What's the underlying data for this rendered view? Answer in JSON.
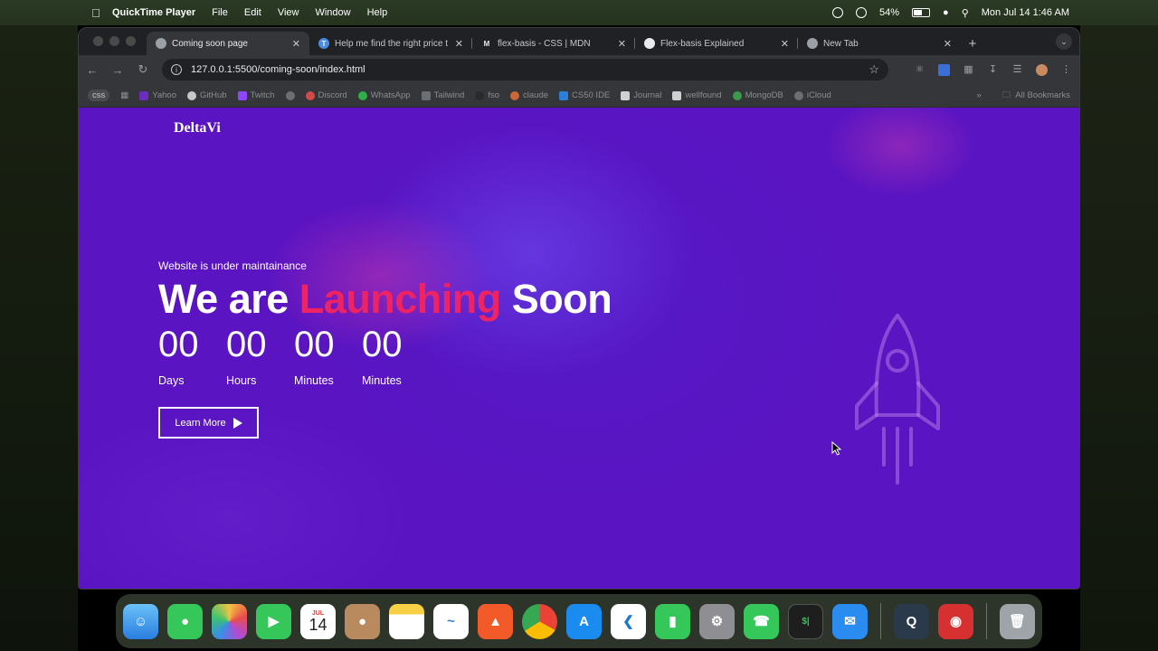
{
  "menubar": {
    "app_name": "QuickTime Player",
    "menus": [
      "File",
      "Edit",
      "View",
      "Window",
      "Help"
    ],
    "battery": "54%",
    "datetime": "Mon Jul 14  1:46 AM"
  },
  "tabs": [
    {
      "title": "Coming soon page",
      "active": true
    },
    {
      "title": "Help me find the right price t",
      "active": false
    },
    {
      "title": "flex-basis - CSS | MDN",
      "active": false
    },
    {
      "title": "Flex-basis Explained",
      "active": false
    },
    {
      "title": "New Tab",
      "active": false
    }
  ],
  "address": {
    "url": "127.0.0.1:5500/coming-soon/index.html"
  },
  "bookmarks": {
    "items": [
      "css",
      "Yahoo",
      "GitHub",
      "Twitch",
      "Discord",
      "WhatsApp",
      "Tailwind",
      "fso",
      "claude",
      "CS50 IDE",
      "Journal",
      "wellfound",
      "MongoDB",
      "iCloud"
    ],
    "all_label": "All Bookmarks"
  },
  "page": {
    "logo": "DeltaVi",
    "subtitle": "Website is under maintainance",
    "headline_pre": "We are",
    "headline_accent": "Launching",
    "headline_post": "Soon",
    "counters": [
      {
        "value": "00",
        "label": "Days"
      },
      {
        "value": "00",
        "label": "Hours"
      },
      {
        "value": "00",
        "label": "Minutes"
      },
      {
        "value": "00",
        "label": "Minutes"
      }
    ],
    "cta_label": "Learn More",
    "accent_color": "#ee2364"
  },
  "dock": {
    "calendar_month": "JUL",
    "calendar_day": "14"
  }
}
